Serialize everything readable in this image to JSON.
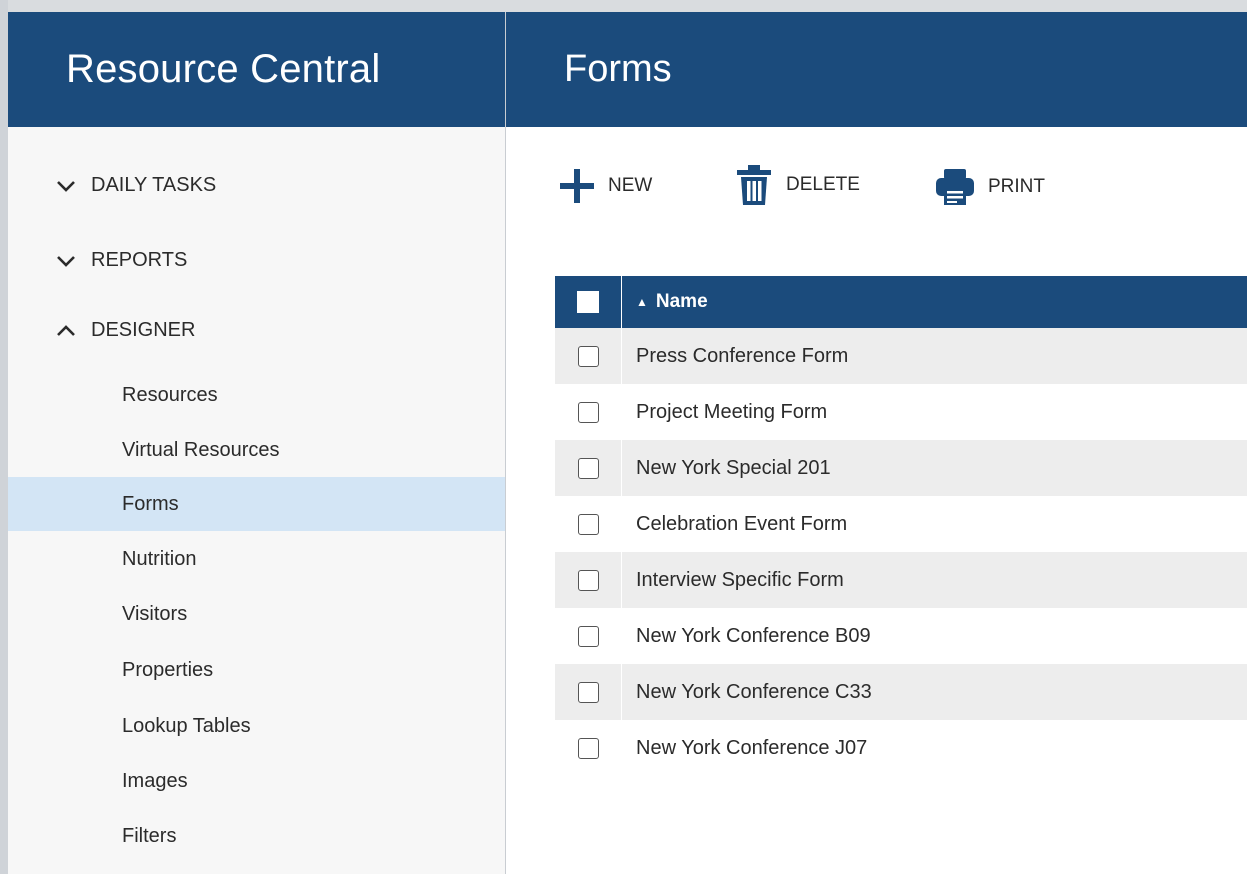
{
  "sidebar": {
    "app_title": "Resource Central",
    "sections": [
      {
        "label": "DAILY TASKS",
        "expanded": false,
        "icon": "chevron-down-icon"
      },
      {
        "label": "REPORTS",
        "expanded": false,
        "icon": "chevron-down-icon"
      },
      {
        "label": "DESIGNER",
        "expanded": true,
        "icon": "chevron-up-icon"
      }
    ],
    "designer_items": [
      {
        "label": "Resources",
        "active": false
      },
      {
        "label": "Virtual Resources",
        "active": false
      },
      {
        "label": "Forms",
        "active": true
      },
      {
        "label": "Nutrition",
        "active": false
      },
      {
        "label": "Visitors",
        "active": false
      },
      {
        "label": "Properties",
        "active": false
      },
      {
        "label": "Lookup Tables",
        "active": false
      },
      {
        "label": "Images",
        "active": false
      },
      {
        "label": "Filters",
        "active": false
      }
    ]
  },
  "main": {
    "page_title": "Forms",
    "toolbar": {
      "new_label": "NEW",
      "delete_label": "DELETE",
      "print_label": "PRINT",
      "icons": [
        "plus-icon",
        "trash-icon",
        "printer-icon"
      ]
    },
    "grid": {
      "column_name_header": "Name",
      "sort_indicator": "▲",
      "rows": [
        {
          "name": "Press Conference Form",
          "checked": false
        },
        {
          "name": "Project Meeting Form",
          "checked": false
        },
        {
          "name": "New York Special 201",
          "checked": false
        },
        {
          "name": "Celebration Event Form",
          "checked": false
        },
        {
          "name": "Interview Specific Form",
          "checked": false
        },
        {
          "name": "New York Conference B09",
          "checked": false
        },
        {
          "name": "New York Conference C33",
          "checked": false
        },
        {
          "name": "New York Conference J07",
          "checked": false
        }
      ]
    }
  },
  "colors": {
    "header_bg": "#1b4b7c",
    "sidebar_bg": "#f7f7f7",
    "active_item_bg": "#d3e5f5",
    "row_alt_bg": "#ededed"
  }
}
